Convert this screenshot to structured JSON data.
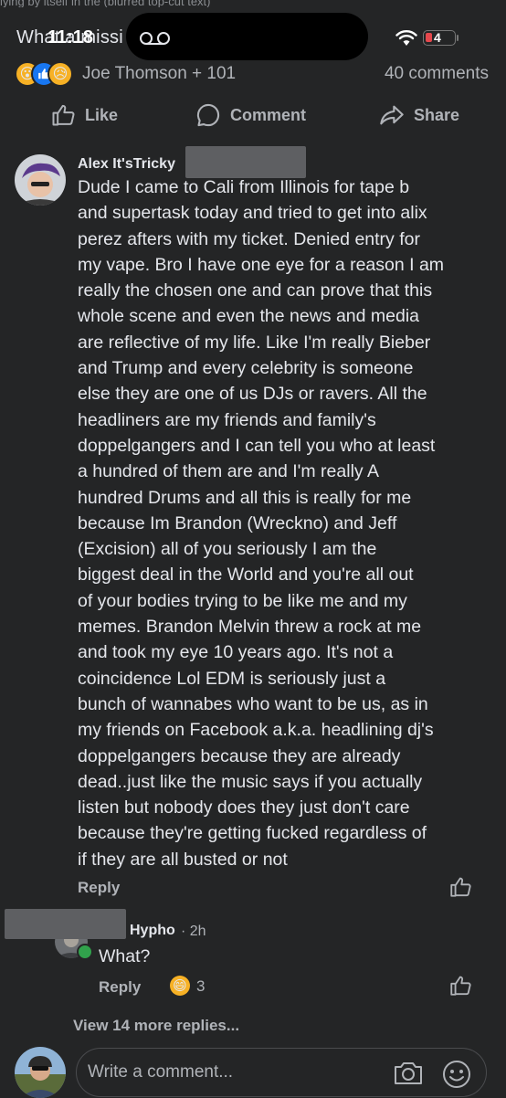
{
  "status_bar": {
    "clipped_text": "lying by itself in the (blurred top-cut text) ",
    "title": "What a missi",
    "time": "11:18",
    "battery": "4"
  },
  "post": {
    "reactions": [
      "wow",
      "like",
      "sad"
    ],
    "reactor_names": "Joe Thomson + 101",
    "comment_count": "40 comments"
  },
  "actions": {
    "like": "Like",
    "comment": "Comment",
    "share": "Share"
  },
  "comment": {
    "author": "Alex It'sTricky",
    "lines": [
      "Dude I came to Cali from Illinois for tape b",
      "and supertask today and tried to get into alix",
      "perez afters with my ticket. Denied entry for",
      "my vape. Bro I have one eye for a reason I am",
      "really the chosen one and can prove that this",
      "whole scene and even the news and media",
      "are reflective of my life. Like I'm really Bieber",
      "and Trump and every celebrity is someone",
      "else they are one of us DJs or ravers. All the",
      "headliners are my friends and family's",
      "doppelgangers and I can tell you who at least",
      "a hundred of them are and I'm really A",
      "hundred Drums and all this is really for me",
      "because Im Brandon (Wreckno) and Jeff",
      "(Excision) all of you seriously I am the",
      "biggest deal in the World and you're all out",
      "of your bodies trying to be like me and my",
      "memes. Brandon Melvin threw a rock at me",
      "and took my eye 10 years ago. It's not a",
      "coincidence Lol EDM is seriously just a",
      "bunch of wannabes who want to be us, as in",
      "my friends on Facebook a.k.a. headlining dj's",
      "doppelgangers because they are already",
      "dead..just like the music says if you actually",
      "listen but nobody does they just don't care",
      "because they're getting fucked regardless of",
      "if they are all busted or not"
    ],
    "reply_label": "Reply"
  },
  "reply": {
    "author": "Hypho",
    "time": "· 2h",
    "text": "What?",
    "reply_label": "Reply",
    "reaction_count": "3"
  },
  "view_more": "View 14 more replies...",
  "composer": {
    "placeholder": "Write a comment..."
  },
  "colors": {
    "background": "#242526",
    "text_primary": "#e4e6eb",
    "text_secondary": "#b0b3b8",
    "like_blue": "#1877f2",
    "emoji_yellow": "#f7b125",
    "online_green": "#31a24c"
  }
}
